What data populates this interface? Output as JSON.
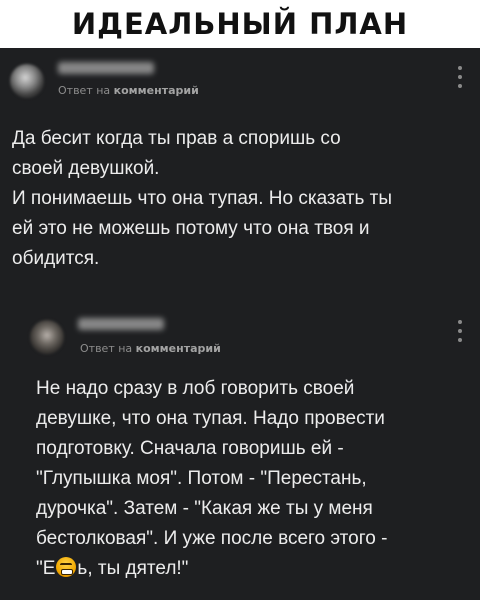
{
  "meme": {
    "title": "ИДЕАЛЬНЫЙ ПЛАН"
  },
  "comments": [
    {
      "author": "",
      "reply_prefix": "Ответ на",
      "reply_target": "комментарий",
      "paragraphs": [
        "Да бесит когда ты прав а споришь со своей девушкой.",
        "И понимаешь что она тупая. Но сказать ты ей это не можешь потому что она твоя и обидится."
      ],
      "lines": [
        "Да бесит когда ты прав а споришь со",
        "своей девушкой.",
        "И понимаешь что она тупая. Но сказать ты",
        "ей это не можешь потому что она твоя и",
        "обидится."
      ]
    },
    {
      "author": "",
      "reply_prefix": "Ответ на",
      "reply_target": "комментарий",
      "lines": [
        "Не надо сразу в лоб говорить своей",
        "девушке, что она тупая. Надо провести",
        "подготовку. Сначала говоришь ей -",
        "\"Глупышка моя\". Потом - \"Перестань,",
        "дурочка\". Затем - \"Какая же ты у меня",
        "бестолковая\". И уже после всего этого -"
      ],
      "last_line_start": "\"Е",
      "last_line_end": "ь, ты дятел!\"",
      "censor_emoji": "angry-face"
    }
  ],
  "colors": {
    "panel_bg": "#1e1f21",
    "text": "#ececec",
    "meta_text": "#8d8d8d"
  },
  "icons": [
    "more-vertical-icon",
    "avatar",
    "angry-face-emoji"
  ]
}
